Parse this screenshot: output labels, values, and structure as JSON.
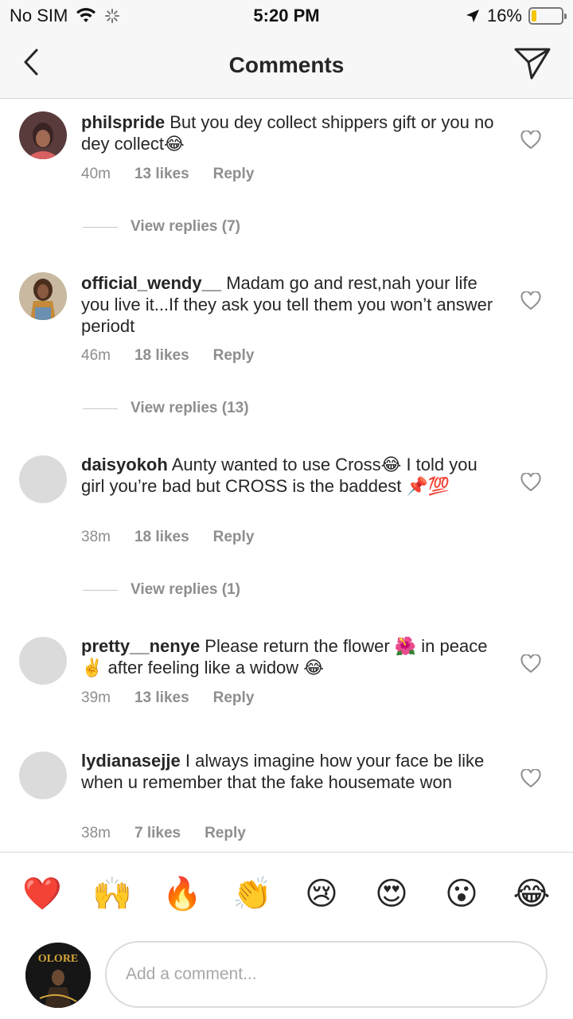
{
  "status_bar": {
    "carrier": "No SIM",
    "time": "5:20 PM",
    "battery_percent": "16%",
    "battery_level": 0.16,
    "battery_color": "#f5c400"
  },
  "header": {
    "title": "Comments",
    "back_icon": "chevron-left-icon",
    "send_icon": "paper-plane-icon"
  },
  "comments": [
    {
      "username": "philspride",
      "text": " But you dey collect shippers gift or you no dey collect😂",
      "time": "40m",
      "likes": "13 likes",
      "reply": "Reply",
      "view_replies": "View replies (7)"
    },
    {
      "username": "official_wendy__",
      "text": " Madam go and rest,nah your life you live it...If they ask you tell them you won’t answer periodt",
      "time": "46m",
      "likes": "18 likes",
      "reply": "Reply",
      "view_replies": "View replies (13)"
    },
    {
      "username": "daisyokoh",
      "text": " Aunty wanted to use Cross😂 I told you girl you’re bad but CROSS is the baddest 📌💯",
      "time": "38m",
      "likes": "18 likes",
      "reply": "Reply",
      "view_replies": "View replies (1)"
    },
    {
      "username": "pretty__nenye",
      "text": " Please return the flower 🌺 in peace ✌️ after feeling like a widow 😂",
      "time": "39m",
      "likes": "13 likes",
      "reply": "Reply"
    },
    {
      "username": "lydianasejje",
      "text": " I always imagine how your face be like when u remember that the fake housemate won",
      "time": "38m",
      "likes": "7 likes",
      "reply": "Reply"
    }
  ],
  "emoji_bar": [
    "❤️",
    "🙌",
    "🔥",
    "👏",
    "😢",
    "😍",
    "😮",
    "😂"
  ],
  "composer": {
    "placeholder": "Add a comment...",
    "avatar_text": "OLORE"
  }
}
